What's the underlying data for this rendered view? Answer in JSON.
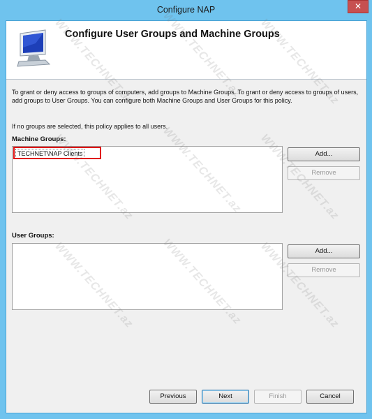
{
  "window": {
    "title": "Configure NAP",
    "close_glyph": "✕"
  },
  "header": {
    "title": "Configure User Groups and Machine Groups",
    "icon": "computer-monitor-icon"
  },
  "description": "To grant or deny access to groups of computers, add groups to Machine Groups. To grant or deny access to groups of users, add groups to User Groups. You can configure both Machine Groups and User Groups for this policy.",
  "note": "If no groups are selected, this policy applies to all users.",
  "machine_groups": {
    "label": "Machine Groups:",
    "items": [
      "TECHNET\\NAP Clients"
    ],
    "add_label": "Add...",
    "remove_label": "Remove"
  },
  "user_groups": {
    "label": "User Groups:",
    "items": [],
    "add_label": "Add...",
    "remove_label": "Remove"
  },
  "footer": {
    "previous_label": "Previous",
    "next_label": "Next",
    "finish_label": "Finish",
    "cancel_label": "Cancel"
  },
  "watermark": "WWW.TECHNET.az",
  "colors": {
    "title_bar": "#6fc3ee",
    "close_button": "#c75050",
    "highlight_box": "#e01010"
  }
}
